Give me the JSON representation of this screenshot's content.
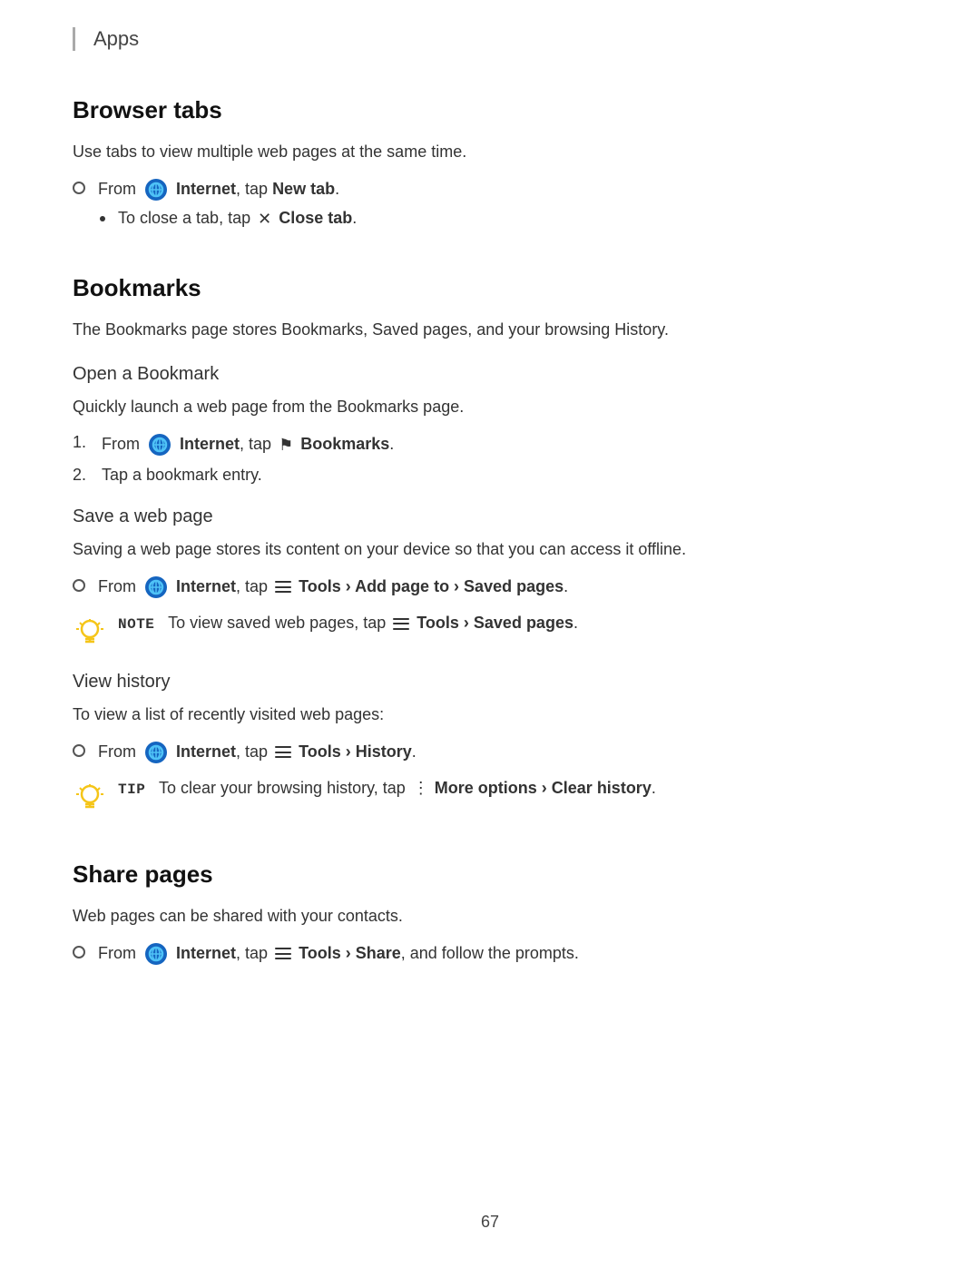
{
  "header": {
    "label": "Apps"
  },
  "sections": {
    "browserTabs": {
      "title": "Browser tabs",
      "description": "Use tabs to view multiple web pages at the same time.",
      "instructions": [
        {
          "type": "circle-bullet",
          "text_before": "From",
          "icon": "internet",
          "app_name": "Internet",
          "text_after": ", tap",
          "action": "New tab",
          "action_bold": true
        }
      ],
      "sub_instructions": [
        {
          "type": "dot-bullet",
          "text": "To close a tab, tap",
          "icon": "close",
          "action": "Close tab",
          "action_bold": true
        }
      ]
    },
    "bookmarks": {
      "title": "Bookmarks",
      "description": "The Bookmarks page stores Bookmarks, Saved pages, and your browsing History.",
      "subsections": {
        "openBookmark": {
          "title": "Open a Bookmark",
          "description": "Quickly launch a web page from the Bookmarks page.",
          "numbered_steps": [
            {
              "number": "1.",
              "text_before": "From",
              "icon": "internet",
              "app_name": "Internet",
              "text_after": ", tap",
              "icon2": "bookmark-flag",
              "action": "Bookmarks",
              "action_bold": true
            },
            {
              "number": "2.",
              "text": "Tap a bookmark entry."
            }
          ]
        },
        "saveWebPage": {
          "title": "Save a web page",
          "description": "Saving a web page stores its content on your device so that you can access it offline.",
          "instructions": [
            {
              "type": "circle-bullet",
              "text_before": "From",
              "icon": "internet",
              "app_name": "Internet",
              "text_after": ", tap",
              "icon2": "hamburger",
              "action": "Tools › Add page to › Saved pages",
              "action_bold": true
            }
          ],
          "note": {
            "label": "NOTE",
            "text_before": "To view saved web pages, tap",
            "icon": "hamburger",
            "action": "Tools › Saved pages",
            "action_bold": true
          }
        },
        "viewHistory": {
          "title": "View history",
          "description": "To view a list of recently visited web pages:",
          "instructions": [
            {
              "type": "circle-bullet",
              "text_before": "From",
              "icon": "internet",
              "app_name": "Internet",
              "text_after": ", tap",
              "icon2": "hamburger",
              "action": "Tools › History",
              "action_bold": true
            }
          ],
          "tip": {
            "label": "TIP",
            "text_before": "To clear your browsing history, tap",
            "icon": "more-dots",
            "action": "More options › Clear history",
            "action_bold": true
          }
        }
      }
    },
    "sharePages": {
      "title": "Share pages",
      "description": "Web pages can be shared with your contacts.",
      "instructions": [
        {
          "type": "circle-bullet",
          "text_before": "From",
          "icon": "internet",
          "app_name": "Internet",
          "text_after": ", tap",
          "icon2": "hamburger",
          "action": "Tools › Share",
          "action_bold": true,
          "text_end": ", and follow the prompts."
        }
      ]
    }
  },
  "footer": {
    "page_number": "67"
  }
}
